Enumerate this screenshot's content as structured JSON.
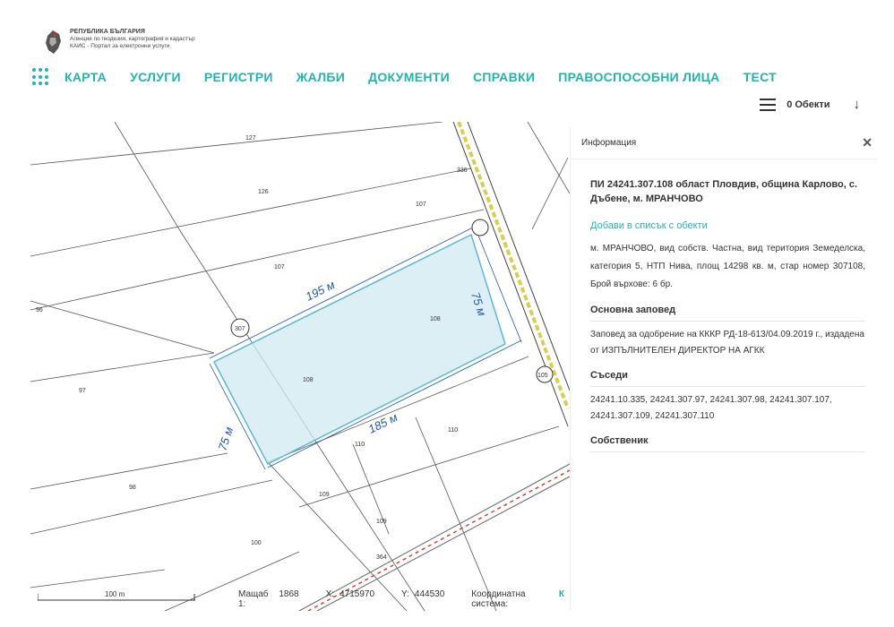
{
  "logo": {
    "line1": "РЕПУБЛИКА БЪЛГАРИЯ",
    "line2": "Агенция по геодезия, картография и кадастър",
    "line3": "КАИС - Портал за електронни услуги"
  },
  "nav": {
    "items": [
      "КАРТА",
      "УСЛУГИ",
      "РЕГИСТРИ",
      "ЖАЛБИ",
      "ДОКУМЕНТИ",
      "СПРАВКИ",
      "ПРАВОСПОСОБНИ ЛИЦА",
      "ТЕСТ"
    ]
  },
  "objects": {
    "count_label": "0 Обекти"
  },
  "map": {
    "labels": {
      "p127": "127",
      "p126": "126",
      "p107a": "107",
      "p107b": "107",
      "p96": "96",
      "p97": "97",
      "p98": "98",
      "p100": "100",
      "p109a": "109",
      "p109b": "109",
      "p110a": "110",
      "p110b": "110",
      "p108a": "108",
      "p108b": "108",
      "p336": "336",
      "p105": "105",
      "p307": "307",
      "p364": "364",
      "dim_top": "195 м",
      "dim_bottom": "185 м",
      "dim_left": "75 м",
      "dim_right": "75 м"
    },
    "scale_label": "100 m",
    "status": {
      "scale_label": "Мащаб 1:",
      "scale_value": "1868",
      "x_label": "X:",
      "x_value": "4715970",
      "y_label": "Y:",
      "y_value": "444530",
      "coord_sys_label": "Координатна система:",
      "coord_sys_value": "К"
    }
  },
  "panel": {
    "title": "Информация",
    "parcel_title": "ПИ 24241.307.108 област Пловдив, община Карлово, с. Дъбене, м. МРАНЧОВО",
    "add_link": "Добави в списък с обекти",
    "description": "м. МРАНЧОВО, вид собств. Частна, вид територия Земеделска, категория 5, НТП Нива, площ 14298 кв. м, стар номер 307108, Брой върхове: 6 бр.",
    "order_title": "Основна заповед",
    "order_text": "Заповед за одобрение на КККР РД-18-613/04.09.2019 г., издадена от ИЗПЪЛНИТЕЛЕН ДИРЕКТОР НА АГКК",
    "neighbors_title": "Съседи",
    "neighbors_text": "24241.10.335, 24241.307.97, 24241.307.98, 24241.307.107, 24241.307.109, 24241.307.110",
    "owner_title": "Собственик"
  },
  "colors": {
    "accent": "#1fb5b0",
    "parcel_fill": "#cfe9f1",
    "parcel_stroke": "#5ab8d6",
    "dim_line": "#1e5aa8"
  }
}
